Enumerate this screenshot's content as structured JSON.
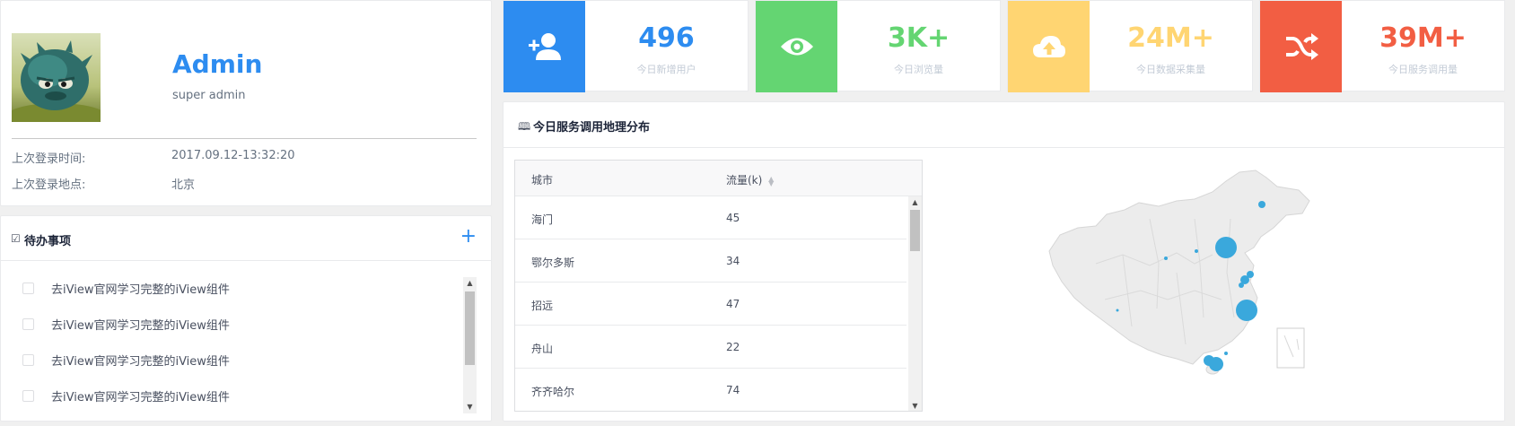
{
  "profile": {
    "name": "Admin",
    "role": "super admin",
    "last_login_time_label": "上次登录时间:",
    "last_login_time": "2017.09.12-13:32:20",
    "last_login_place_label": "上次登录地点:",
    "last_login_place": "北京"
  },
  "todo": {
    "title": "待办事项",
    "add_label": "+",
    "items": [
      "去iView官网学习完整的iView组件",
      "去iView官网学习完整的iView组件",
      "去iView官网学习完整的iView组件",
      "去iView官网学习完整的iView组件"
    ]
  },
  "stats": [
    {
      "value": "496",
      "label": "今日新增用户",
      "color": "#2d8cf0",
      "icon": "add-user-icon"
    },
    {
      "value": "3K+",
      "label": "今日浏览量",
      "color": "#64d572",
      "icon": "eye-icon"
    },
    {
      "value": "24M+",
      "label": "今日数据采集量",
      "color": "#ffd572",
      "icon": "cloud-upload-icon"
    },
    {
      "value": "39M+",
      "label": "今日服务调用量",
      "color": "#f25e43",
      "icon": "shuffle-icon"
    }
  ],
  "map_card": {
    "title": "今日服务调用地理分布",
    "table": {
      "columns": [
        "城市",
        "流量(k)"
      ],
      "rows": [
        {
          "city": "海门",
          "traffic": "45"
        },
        {
          "city": "鄂尔多斯",
          "traffic": "34"
        },
        {
          "city": "招远",
          "traffic": "47"
        },
        {
          "city": "舟山",
          "traffic": "22"
        },
        {
          "city": "齐齐哈尔",
          "traffic": "74"
        }
      ]
    }
  }
}
